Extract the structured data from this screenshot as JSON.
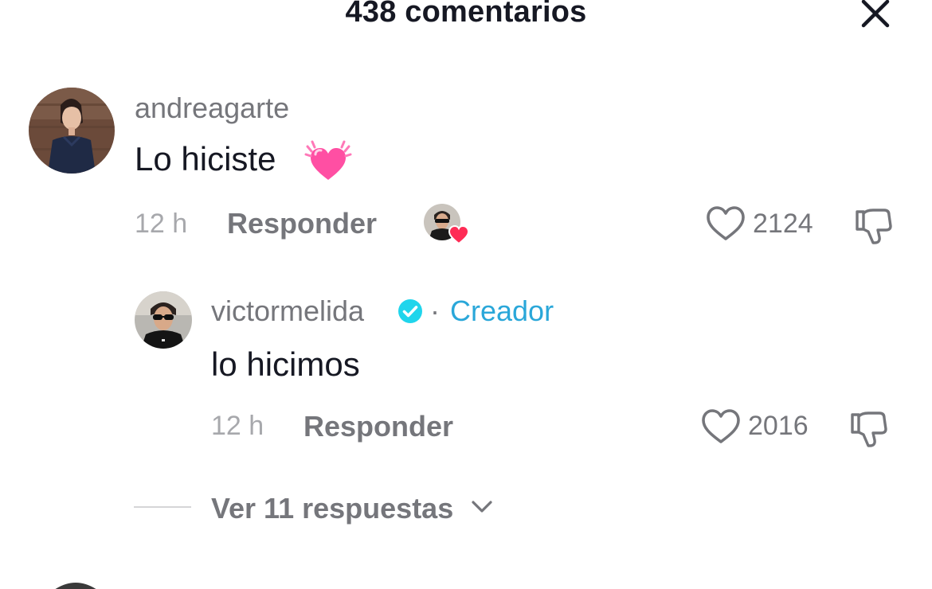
{
  "header": {
    "title": "438 comentarios"
  },
  "comments": [
    {
      "username": "andreagarte",
      "text": "Lo hiciste",
      "emoji": "💓",
      "time": "12 h",
      "reply_label": "Responder",
      "likes": "2124",
      "liked_by_creator": true
    }
  ],
  "replies": [
    {
      "username": "victormelida",
      "verified": true,
      "separator": "·",
      "badge": "Creador",
      "text": "lo hicimos",
      "time": "12 h",
      "reply_label": "Responder",
      "likes": "2016"
    }
  ],
  "view_replies": {
    "label": "Ver 11 respuestas"
  },
  "colors": {
    "text_primary": "#161823",
    "text_secondary": "#75767b",
    "text_tertiary": "#a7a8ac",
    "creator_accent": "#2aa7d9",
    "heart_red": "#fe2c55"
  },
  "icons": {
    "close": "close-icon",
    "like": "heart-outline-icon",
    "dislike": "thumbs-down-icon",
    "verified": "verified-badge-icon",
    "expand": "chevron-down-icon"
  }
}
